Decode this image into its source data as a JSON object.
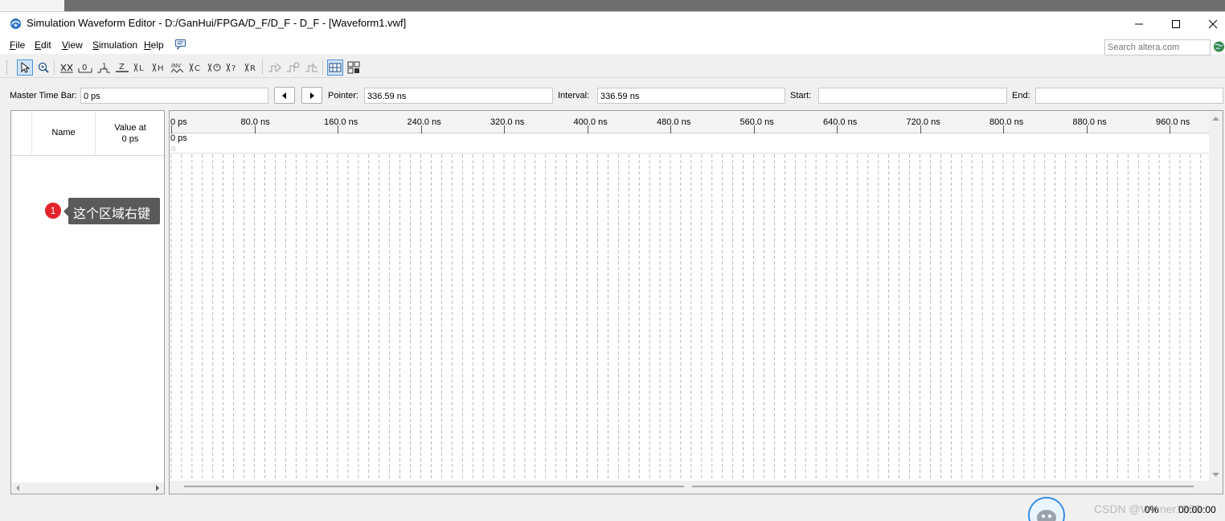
{
  "window": {
    "title": "Simulation Waveform Editor - D:/GanHui/FPGA/D_F/D_F - D_F - [Waveform1.vwf]"
  },
  "menu": {
    "file": {
      "hotkey": "F",
      "rest": "ile"
    },
    "edit": {
      "hotkey": "E",
      "rest": "dit"
    },
    "view": {
      "hotkey": "V",
      "rest": "iew"
    },
    "simulation": {
      "hotkey": "S",
      "rest": "imulation"
    },
    "help": {
      "hotkey": "H",
      "rest": "elp"
    }
  },
  "search": {
    "placeholder": "Search altera.com"
  },
  "timebar": {
    "master_label": "Master Time Bar:",
    "master_value": "0 ps",
    "pointer_label": "Pointer:",
    "pointer_value": "336.59 ns",
    "interval_label": "Interval:",
    "interval_value": "336.59 ns",
    "start_label": "Start:",
    "start_value": "",
    "end_label": "End:",
    "end_value": ""
  },
  "signals": {
    "name_header": "Name",
    "value_header_line1": "Value at",
    "value_header_line2": "0 ps"
  },
  "callout": {
    "number": "1",
    "text": "这个区域右键"
  },
  "waveform": {
    "ruler_labels": [
      "0 ps",
      "80.0 ns",
      "160.0 ns",
      "240.0 ns",
      "320.0 ns",
      "400.0 ns",
      "480.0 ns",
      "560.0 ns",
      "640.0 ns",
      "720.0 ns",
      "800.0 ns",
      "880.0 ns",
      "960.0 ns"
    ],
    "cursor_label": "0 ps"
  },
  "status": {
    "progress": "0%",
    "elapsed": "00:00:00"
  },
  "watermark": "CSDN @Winner1300"
}
